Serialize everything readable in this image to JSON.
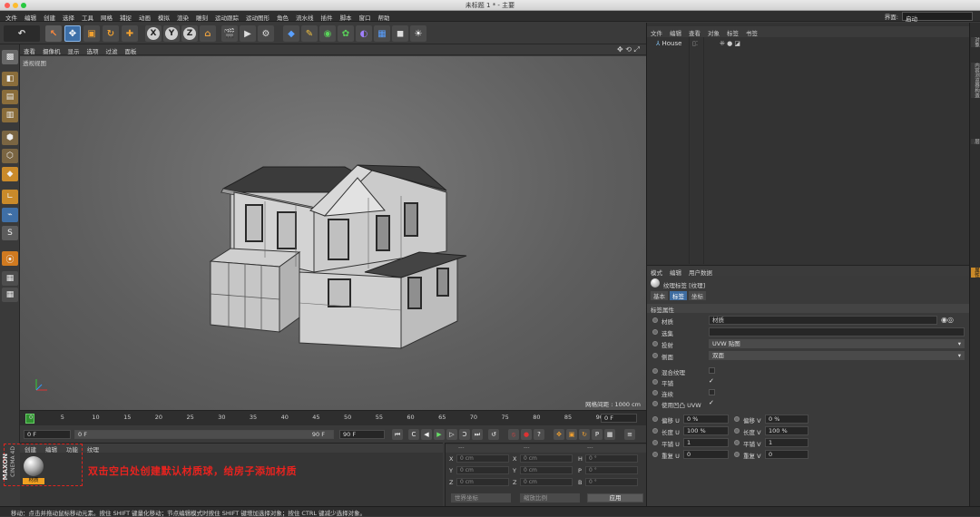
{
  "window": {
    "title": "未标题 1 * - 主要"
  },
  "menubar": {
    "items": [
      "文件",
      "编辑",
      "创建",
      "选择",
      "工具",
      "网格",
      "捕捉",
      "动画",
      "模拟",
      "渲染",
      "雕刻",
      "运动跟踪",
      "运动图形",
      "角色",
      "流水线",
      "插件",
      "脚本",
      "窗口",
      "帮助"
    ],
    "layout_label": "界面:",
    "layout_value": "启动"
  },
  "viewport": {
    "menu": [
      "查看",
      "摄像机",
      "显示",
      "选项",
      "过滤",
      "面板"
    ],
    "label": "透视视图",
    "grid_spacing": "网格间距 : 1000 cm"
  },
  "timeline": {
    "ticks": [
      "0",
      "5",
      "10",
      "15",
      "20",
      "25",
      "30",
      "35",
      "40",
      "45",
      "50",
      "55",
      "60",
      "65",
      "70",
      "75",
      "80",
      "85",
      "90"
    ],
    "current_frame": "0 F",
    "start": "0 F",
    "start_range": "0 F",
    "end_range": "90 F",
    "end": "90 F"
  },
  "materials": {
    "menu": [
      "创建",
      "编辑",
      "功能",
      "纹理"
    ],
    "material_name": "材质"
  },
  "coordinates": {
    "header": [
      "---",
      "---",
      "---"
    ],
    "rows": [
      {
        "a": "X",
        "av": "0 cm",
        "b": "X",
        "bv": "0 cm",
        "c": "H",
        "cv": "0 °"
      },
      {
        "a": "Y",
        "av": "0 cm",
        "b": "Y",
        "bv": "0 cm",
        "c": "P",
        "cv": "0 °"
      },
      {
        "a": "Z",
        "av": "0 cm",
        "b": "Z",
        "bv": "0 cm",
        "c": "B",
        "cv": "0 °"
      }
    ],
    "world_select": "世界坐标",
    "scale_select": "缩放比例",
    "apply_button": "应用"
  },
  "objects": {
    "menu": [
      "文件",
      "编辑",
      "查看",
      "对象",
      "标签",
      "书签"
    ],
    "items": [
      {
        "name": "House"
      }
    ]
  },
  "attributes": {
    "menu": [
      "模式",
      "编辑",
      "用户数据"
    ],
    "tag_title": "纹理标签 [纹理]",
    "tabs": [
      "基本",
      "标签",
      "坐标"
    ],
    "section": "标签属性",
    "material_label": "材质",
    "material_value": "材质",
    "selection_label": "选集",
    "selection_value": "",
    "projection_label": "投射",
    "projection_value": "UVW 贴图",
    "side_label": "侧面",
    "side_value": "双面",
    "mix_label": "混合纹理",
    "tile_label": "平铺",
    "seamless_label": "连续",
    "uvw_bump_label": "使用凹凸 UVW",
    "params": [
      {
        "l1": "偏移 U",
        "v1": "0 %",
        "l2": "偏移 V",
        "v2": "0 %"
      },
      {
        "l1": "长度 U",
        "v1": "100 %",
        "l2": "长度 V",
        "v2": "100 %"
      },
      {
        "l1": "平铺 U",
        "v1": "1",
        "l2": "平铺 V",
        "v2": "1"
      },
      {
        "l1": "重复 U",
        "v1": "0",
        "l2": "重复 V",
        "v2": "0"
      }
    ]
  },
  "sidetabs": [
    "对象",
    "内容浏览器",
    "构造",
    "属性",
    "层"
  ],
  "annotation": "双击空白处创建默认材质球，给房子添加材质",
  "statusbar": "移动：点击并拖动鼠标移动元素。按住 SHIFT 键量化移动；节点编辑模式时按住 SHIFT 键增加选择对象；按住 CTRL 键减少选择对象。",
  "logo": {
    "text1": "MAXON",
    "text2": "CINEMA 4D"
  }
}
